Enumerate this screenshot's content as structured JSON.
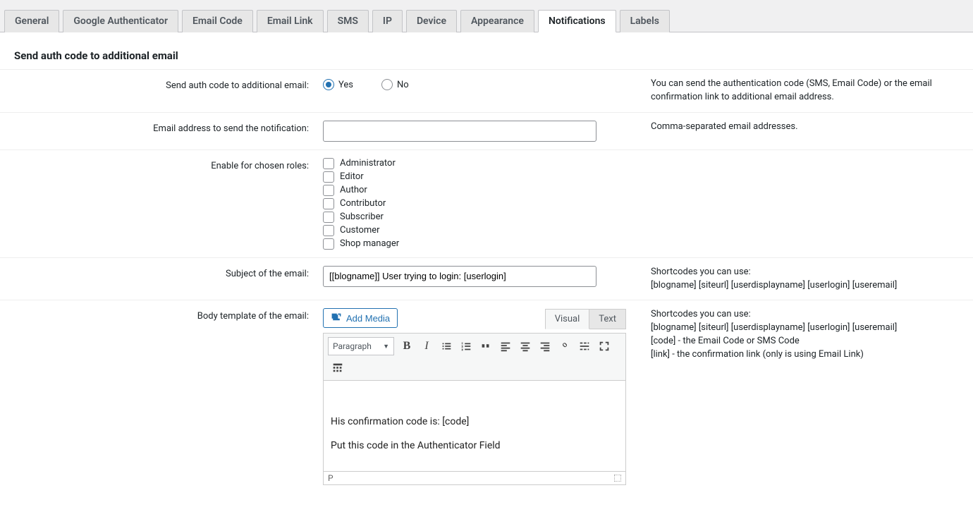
{
  "tabs": [
    "General",
    "Google Authenticator",
    "Email Code",
    "Email Link",
    "SMS",
    "IP",
    "Device",
    "Appearance",
    "Notifications",
    "Labels"
  ],
  "active_tab": "Notifications",
  "section_title": "Send auth code to additional email",
  "rows": {
    "send_code": {
      "label": "Send auth code to additional email:",
      "options": {
        "yes": "Yes",
        "no": "No"
      },
      "value": "yes",
      "help": "You can send the authentication code (SMS, Email Code) or the email confirmation link to additional email address."
    },
    "email_addr": {
      "label": "Email address to send the notification:",
      "value": "",
      "help": "Comma-separated email addresses."
    },
    "roles": {
      "label": "Enable for chosen roles:",
      "items": [
        "Administrator",
        "Editor",
        "Author",
        "Contributor",
        "Subscriber",
        "Customer",
        "Shop manager"
      ]
    },
    "subject": {
      "label": "Subject of the email:",
      "value": "[[blogname]] User trying to login: [userlogin]",
      "help_line1": "Shortcodes you can use:",
      "help_line2": "[blogname] [siteurl] [userdisplayname] [userlogin] [useremail]"
    },
    "body": {
      "label": "Body template of the email:",
      "add_media": "Add Media",
      "tabs_visual": "Visual",
      "tabs_text": "Text",
      "para_label": "Paragraph",
      "content_line1": "His confirmation code is: [code]",
      "content_line2": "Put this code in the Authenticator Field",
      "status_path": "P",
      "help_line1": "Shortcodes you can use:",
      "help_line2": "[blogname] [siteurl] [userdisplayname] [userlogin] [useremail]",
      "help_line3": "[code] - the Email Code or SMS Code",
      "help_line4": "[link] - the confirmation link (only is using Email Link)"
    }
  }
}
